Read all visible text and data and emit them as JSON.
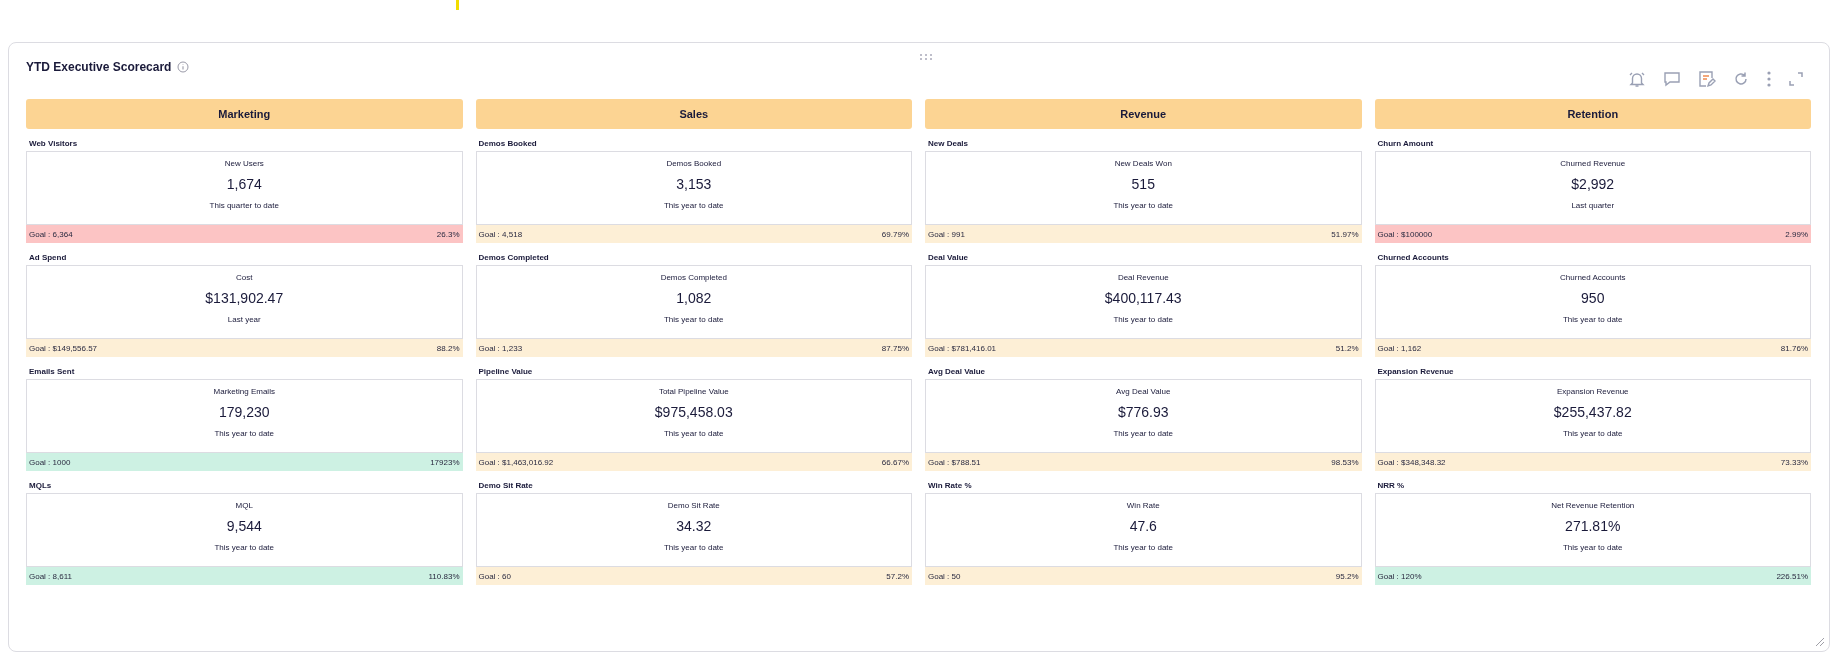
{
  "title": "YTD Executive Scorecard",
  "columns": [
    {
      "heading": "Marketing",
      "metrics": [
        {
          "label": "Web Visitors",
          "name": "New Users",
          "value": "1,674",
          "period": "This quarter to date",
          "goal": "Goal : 6,364",
          "percent": "26.3%",
          "color": "#fcc4c4"
        },
        {
          "label": "Ad Spend",
          "name": "Cost",
          "value": "$131,902.47",
          "period": "Last year",
          "goal": "Goal : $149,556.57",
          "percent": "88.2%",
          "color": "#fdefd6"
        },
        {
          "label": "Emails Sent",
          "name": "Marketing Emails",
          "value": "179,230",
          "period": "This year to date",
          "goal": "Goal : 1000",
          "percent": "17923%",
          "color": "#cdf1e3"
        },
        {
          "label": "MQLs",
          "name": "MQL",
          "value": "9,544",
          "period": "This year to date",
          "goal": "Goal : 8,611",
          "percent": "110.83%",
          "color": "#cdf1e3"
        }
      ]
    },
    {
      "heading": "Sales",
      "metrics": [
        {
          "label": "Demos Booked",
          "name": "Demos Booked",
          "value": "3,153",
          "period": "This year to date",
          "goal": "Goal : 4,518",
          "percent": "69.79%",
          "color": "#fdefd6"
        },
        {
          "label": "Demos Completed",
          "name": "Demos Completed",
          "value": "1,082",
          "period": "This year to date",
          "goal": "Goal : 1,233",
          "percent": "87.75%",
          "color": "#fdefd6"
        },
        {
          "label": "Pipeline Value",
          "name": "Total Pipeline Value",
          "value": "$975,458.03",
          "period": "This year to date",
          "goal": "Goal : $1,463,016.92",
          "percent": "66.67%",
          "color": "#fdefd6"
        },
        {
          "label": "Demo Sit Rate",
          "name": "Demo Sit Rate",
          "value": "34.32",
          "period": "This year to date",
          "goal": "Goal : 60",
          "percent": "57.2%",
          "color": "#fdefd6"
        }
      ]
    },
    {
      "heading": "Revenue",
      "metrics": [
        {
          "label": "New Deals",
          "name": "New Deals Won",
          "value": "515",
          "period": "This year to date",
          "goal": "Goal : 991",
          "percent": "51.97%",
          "color": "#fdefd6"
        },
        {
          "label": "Deal Value",
          "name": "Deal Revenue",
          "value": "$400,117.43",
          "period": "This year to date",
          "goal": "Goal : $781,416.01",
          "percent": "51.2%",
          "color": "#fdefd6"
        },
        {
          "label": "Avg Deal Value",
          "name": "Avg Deal Value",
          "value": "$776.93",
          "period": "This year to date",
          "goal": "Goal : $788.51",
          "percent": "98.53%",
          "color": "#fdefd6"
        },
        {
          "label": "Win Rate %",
          "name": "Win Rate",
          "value": "47.6",
          "period": "This year to date",
          "goal": "Goal : 50",
          "percent": "95.2%",
          "color": "#fdefd6"
        }
      ]
    },
    {
      "heading": "Retention",
      "metrics": [
        {
          "label": "Churn Amount",
          "name": "Churned Revenue",
          "value": "$2,992",
          "period": "Last quarter",
          "goal": "Goal : $100000",
          "percent": "2.99%",
          "color": "#fcc4c4"
        },
        {
          "label": "Churned Accounts",
          "name": "Churned Accounts",
          "value": "950",
          "period": "This year to date",
          "goal": "Goal : 1,162",
          "percent": "81.76%",
          "color": "#fdefd6"
        },
        {
          "label": "Expansion Revenue",
          "name": "Expansion Revenue",
          "value": "$255,437.82",
          "period": "This year to date",
          "goal": "Goal : $348,348.32",
          "percent": "73.33%",
          "color": "#fdefd6"
        },
        {
          "label": "NRR %",
          "name": "Net Revenue Retention",
          "value": "271.81%",
          "period": "This year to date",
          "goal": "Goal : 120%",
          "percent": "226.51%",
          "color": "#cdf1e3"
        }
      ]
    }
  ]
}
